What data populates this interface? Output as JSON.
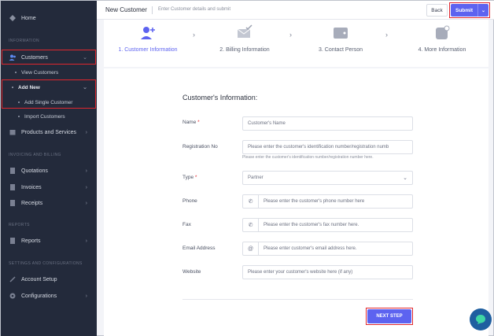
{
  "sidebar": {
    "home": "Home",
    "sections": {
      "information": "INFORMATION",
      "invoicing": "INVOICING AND BILLING",
      "reports": "REPORTS",
      "settings": "SETTINGS AND CONFIGURATIONS"
    },
    "customers": "Customers",
    "view_customers": "View Customers",
    "add_new": "Add New",
    "add_single_customer": "Add Single Customer",
    "import_customers": "Import Customers",
    "products_services": "Products and Services",
    "quotations": "Quotations",
    "invoices": "Invoices",
    "receipts": "Receipts",
    "reports": "Reports",
    "account_setup": "Account Setup",
    "configurations": "Configurations"
  },
  "topbar": {
    "title": "New Customer",
    "subtitle": "Enter Customer details and submit",
    "back": "Back",
    "submit": "Submit"
  },
  "steps": [
    {
      "label": "1. Customer Information",
      "icon": "add-user-icon"
    },
    {
      "label": "2. Billing Information",
      "icon": "envelope-check-icon"
    },
    {
      "label": "3. Contact Person",
      "icon": "wallet-icon"
    },
    {
      "label": "4. More Information",
      "icon": "notification-icon"
    }
  ],
  "form": {
    "title": "Customer's Information:",
    "name_label": "Name",
    "name_placeholder": "Customer's Name",
    "reg_label": "Registration No",
    "reg_placeholder": "Please enter the customer's identification number/registration numb",
    "reg_help": "Please enter the customer's identification number/registration number here.",
    "type_label": "Type",
    "type_value": "Partner",
    "phone_label": "Phone",
    "phone_placeholder": "Please enter the customer's phone number here",
    "fax_label": "Fax",
    "fax_placeholder": "Please enter the customer's fax number here.",
    "email_label": "Email Address",
    "email_placeholder": "Please enter customer's email address here.",
    "website_label": "Website",
    "website_placeholder": "Please enter your customer's website here (if any)",
    "next_step": "NEXT STEP",
    "required_mark": "*"
  },
  "colors": {
    "accent": "#5d63f0",
    "sidebar": "#232a3b",
    "highlight": "#e0272e"
  }
}
